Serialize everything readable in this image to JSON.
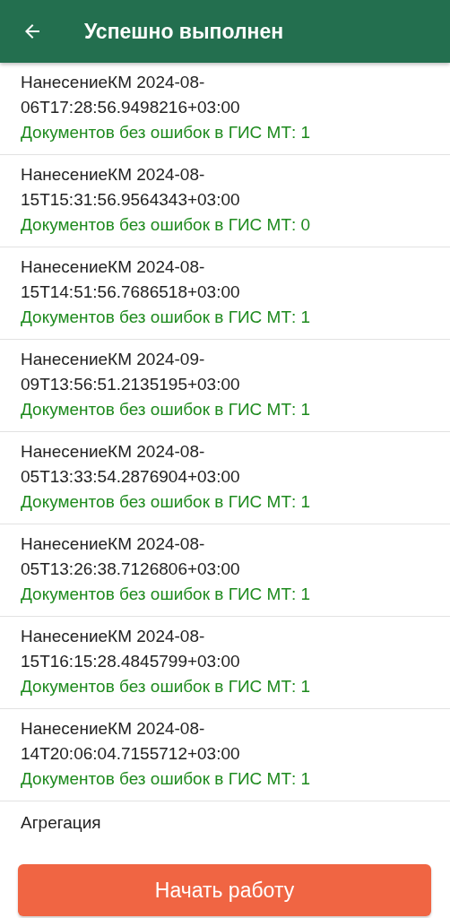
{
  "header": {
    "title": "Успешно выполнен"
  },
  "items": [
    {
      "kind": "record",
      "title": "НанесениеКМ 2024-08-06T17:28:56.9498216+03:00",
      "status": "Документов без ошибок в ГИС МТ: 1"
    },
    {
      "kind": "record",
      "title": "НанесениеКМ 2024-08-15T15:31:56.9564343+03:00",
      "status": "Документов без ошибок в ГИС МТ: 0"
    },
    {
      "kind": "record",
      "title": "НанесениеКМ 2024-08-15T14:51:56.7686518+03:00",
      "status": "Документов без ошибок в ГИС МТ: 1"
    },
    {
      "kind": "record",
      "title": "НанесениеКМ 2024-09-09T13:56:51.2135195+03:00",
      "status": "Документов без ошибок в ГИС МТ: 1"
    },
    {
      "kind": "record",
      "title": "НанесениеКМ 2024-08-05T13:33:54.2876904+03:00",
      "status": "Документов без ошибок в ГИС МТ: 1"
    },
    {
      "kind": "record",
      "title": "НанесениеКМ 2024-08-05T13:26:38.7126806+03:00",
      "status": "Документов без ошибок в ГИС МТ: 1"
    },
    {
      "kind": "record",
      "title": "НанесениеКМ 2024-08-15T16:15:28.4845799+03:00",
      "status": "Документов без ошибок в ГИС МТ: 1"
    },
    {
      "kind": "record",
      "title": "НанесениеКМ 2024-08-14T20:06:04.7155712+03:00",
      "status": "Документов без ошибок в ГИС МТ: 1"
    },
    {
      "kind": "label",
      "title": "Агрегация"
    }
  ],
  "action_button": {
    "label": "Начать работу"
  }
}
